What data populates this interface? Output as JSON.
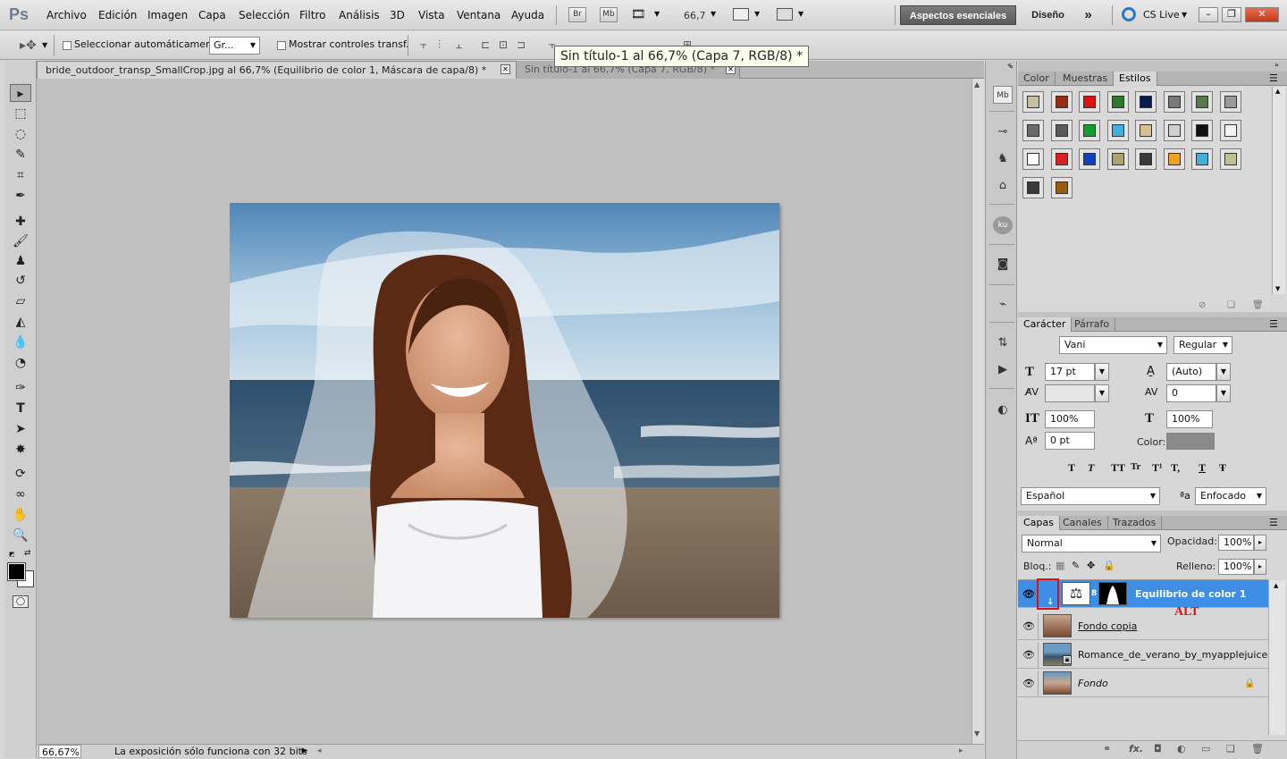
{
  "menubar": {
    "logo": "Ps",
    "items": [
      "Archivo",
      "Edición",
      "Imagen",
      "Capa",
      "Selección",
      "Filtro",
      "Análisis",
      "3D",
      "Vista",
      "Ventana",
      "Ayuda"
    ],
    "bridge": "Br",
    "minibridge": "Mb",
    "zoom": "66,7",
    "workspace_active": "Aspectos esenciales",
    "workspace_other": "Diseño",
    "more": "»",
    "cslive": "CS Live",
    "win_min": "–",
    "win_restore": "❐",
    "win_close": "✕"
  },
  "options": {
    "auto_select_label": "Seleccionar automáticamente:",
    "auto_select_value": "Gr...",
    "show_transform_label": "Mostrar controles transf."
  },
  "tabs": [
    {
      "label": "bride_outdoor_transp_SmallCrop.jpg al 66,7% (Equilibrio de color 1, Máscara de capa/8) *"
    },
    {
      "label": "Sin título-1 al 66,7% (Capa 7, RGB/8) *"
    }
  ],
  "tooltip": "Sin título-1 al 66,7% (Capa 7, RGB/8) *",
  "status": {
    "zoom": "66,67%",
    "message": "La exposición sólo funciona con 32 bits"
  },
  "styles_panel": {
    "tabs": [
      "Color",
      "Muestras",
      "Estilos"
    ],
    "swatch_colors": [
      "#c8bfa0",
      "#9a2a10",
      "#e01010",
      "#2a7a2a",
      "#0a1a50",
      "#7a7a7a",
      "#5a7a4a",
      "#9a9a9a",
      "#6a6a6a",
      "#5a5a5a",
      "#10a030",
      "#40b0e0",
      "#d8c090",
      "#cfcfcf",
      "#101010",
      "#f4f4f4",
      "#ffffff",
      "#e02020",
      "#1040c0",
      "#b0a070",
      "#3a3a3a",
      "#f0a020",
      "#40b0d8",
      "#c0c090",
      "#3a3a3a",
      "#9a5a10"
    ]
  },
  "character": {
    "tabs": [
      "Carácter",
      "Párrafo"
    ],
    "font_family": "Vani",
    "font_style": "Regular",
    "size": "17 pt",
    "leading": "(Auto)",
    "kerning": "",
    "tracking": "0",
    "vscale": "100%",
    "hscale": "100%",
    "baseline": "0 pt",
    "color_label": "Color:",
    "color": "#8a8a8a",
    "language": "Español",
    "antialias_icon": "ªa",
    "antialias": "Enfocado",
    "style_buttons": [
      "T",
      "T",
      "TT",
      "Tr",
      "T¹",
      "T,",
      "T",
      "Ŧ"
    ]
  },
  "layers": {
    "tabs": [
      "Capas",
      "Canales",
      "Trazados"
    ],
    "blend_mode": "Normal",
    "opacity_label": "Opacidad:",
    "opacity": "100%",
    "lock_label": "Bloq.:",
    "fill_label": "Relleno:",
    "fill": "100%",
    "items": [
      {
        "name": "Equilibrio de color 1"
      },
      {
        "name": "Fondo copia"
      },
      {
        "name": "Romance_de_verano_by_myapplejuice"
      },
      {
        "name": "Fondo"
      }
    ],
    "annotation": "ALT",
    "bottom_icons": [
      "⚭",
      "fx.",
      "◘",
      "◐",
      "▭",
      "❏",
      "🗑"
    ]
  }
}
